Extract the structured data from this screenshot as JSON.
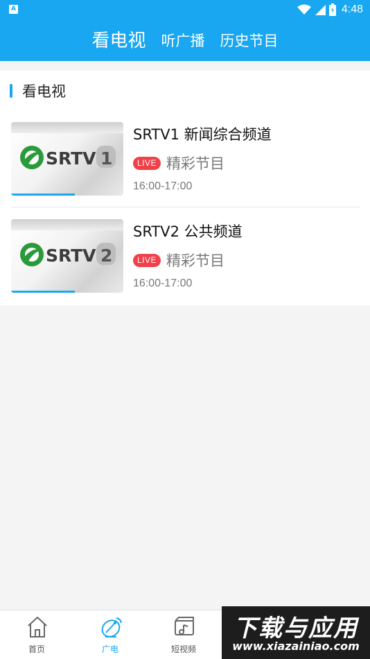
{
  "status_bar": {
    "notification_icon": "A",
    "time": "4:48",
    "icons": [
      "wifi-icon",
      "cell-signal-icon",
      "battery-icon"
    ]
  },
  "header": {
    "tabs": [
      {
        "label": "看电视",
        "active": true
      },
      {
        "label": "听广播",
        "active": false
      },
      {
        "label": "历史节目",
        "active": false
      }
    ]
  },
  "section": {
    "title": "看电视"
  },
  "channels": [
    {
      "thumb_text": "SRTV",
      "thumb_number": "1",
      "title": "SRTV1 新闻综合频道",
      "live_label": "LIVE",
      "program": "精彩节目",
      "time_range": "16:00-17:00"
    },
    {
      "thumb_text": "SRTV",
      "thumb_number": "2",
      "title": "SRTV2 公共频道",
      "live_label": "LIVE",
      "program": "精彩节目",
      "time_range": "16:00-17:00"
    }
  ],
  "bottom_nav": [
    {
      "label": "首页",
      "icon": "home-icon",
      "active": false
    },
    {
      "label": "广电",
      "icon": "satellite-dish-icon",
      "active": true
    },
    {
      "label": "短视频",
      "icon": "short-video-icon",
      "active": false
    }
  ],
  "watermark": {
    "title": "下载与应用",
    "url": "www.xiazainiao.com"
  },
  "colors": {
    "accent": "#18a7f0",
    "live_badge": "#f0404a"
  }
}
